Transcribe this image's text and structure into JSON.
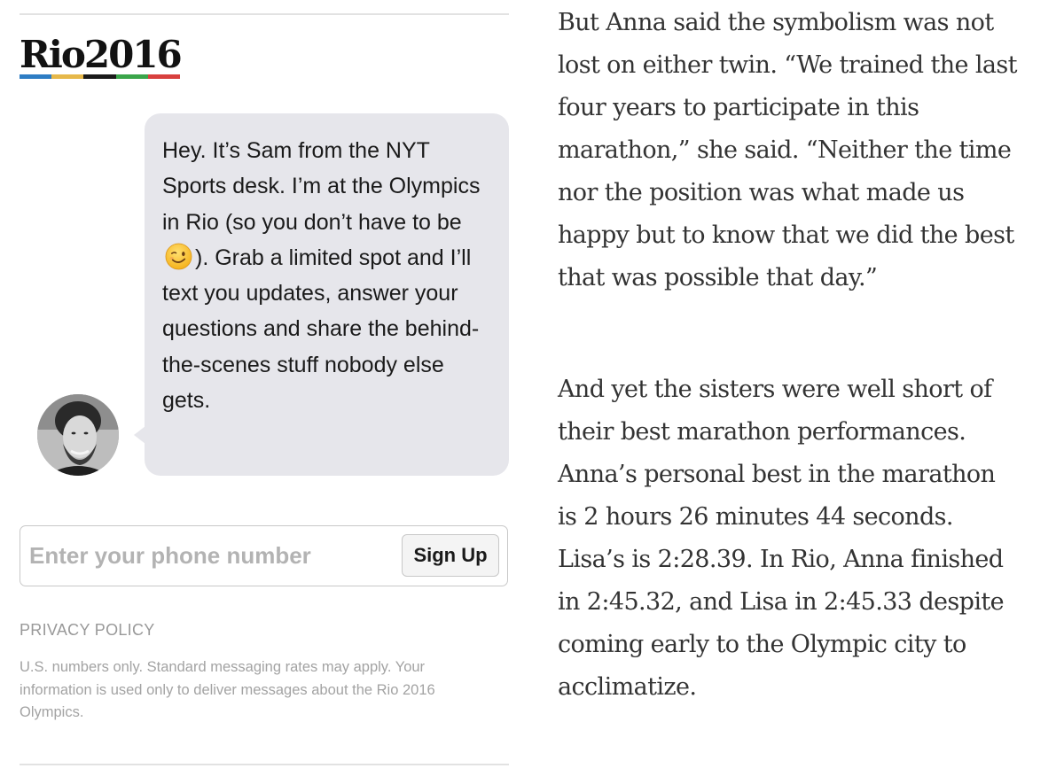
{
  "signup_module": {
    "logo": {
      "text": "Rio2016",
      "stripe_colors": [
        "#2e7dc4",
        "#e6b84a",
        "#1a1a1a",
        "#3aa54a",
        "#d8403e"
      ]
    },
    "bubble": {
      "text_before_emoji": "Hey. It’s Sam from the NYT Sports desk. I’m at the Olympics in Rio (so you don’t have to be",
      "emoji": "winking-face-emoji",
      "text_after_emoji": "). Grab a limited spot and I’ll text you updates, answer your questions and share the behind-the-scenes stuff nobody else gets."
    },
    "avatar": "bearded-man-avatar",
    "phone_input": {
      "placeholder": "Enter your phone number",
      "value": ""
    },
    "signup_button_label": "Sign Up",
    "privacy_link": "PRIVACY POLICY",
    "disclaimer": "U.S. numbers only. Standard messaging rates may apply. Your information is used only to deliver messages about the Rio 2016 Olympics."
  },
  "article": {
    "paragraphs": [
      "But Anna said the symbolism was not lost on either twin. “We trained the last four years to participate in this marathon,” she said. “Neither the time nor the position was what made us happy but to know that we did the best that was possible that day.”",
      "And yet the sisters were well short of their best marathon performances. Anna’s personal best in the marathon is 2 hours 26 minutes 44 seconds. Lisa’s is 2:28.39. In Rio, Anna finished in 2:45.32, and Lisa in 2:45.33 despite coming early to the Olympic city to acclimatize."
    ]
  }
}
